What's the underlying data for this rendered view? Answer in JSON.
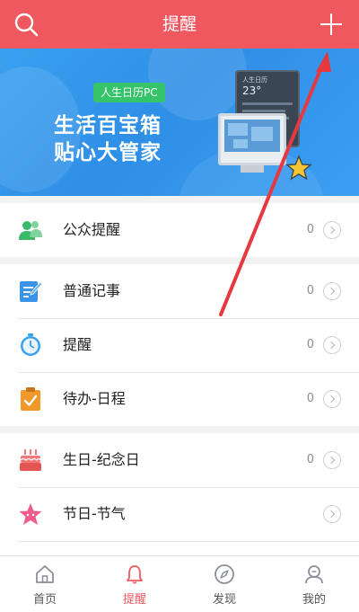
{
  "header": {
    "title": "提醒"
  },
  "banner": {
    "tag": "人生日历PC",
    "line1": "生活百宝箱",
    "line2": "贴心大管家",
    "screen_header": "人生日历",
    "screen_temp": "23°"
  },
  "groups": [
    {
      "items": [
        {
          "label": "公众提醒",
          "count": "0",
          "icon": "people-icon"
        }
      ]
    },
    {
      "items": [
        {
          "label": "普通记事",
          "count": "0",
          "icon": "notepad-icon"
        },
        {
          "label": "提醒",
          "count": "0",
          "icon": "alarm-clock-icon"
        },
        {
          "label": "待办-日程",
          "count": "0",
          "icon": "clipboard-check-icon"
        }
      ]
    },
    {
      "items": [
        {
          "label": "生日-纪念日",
          "count": "0",
          "icon": "cake-icon"
        },
        {
          "label": "节日-节气",
          "count": "",
          "icon": "star-icon"
        }
      ]
    }
  ],
  "tabbar": {
    "tabs": [
      {
        "label": "首页",
        "icon": "home-icon",
        "active": false
      },
      {
        "label": "提醒",
        "icon": "bell-icon",
        "active": true
      },
      {
        "label": "发现",
        "icon": "compass-icon",
        "active": false
      },
      {
        "label": "我的",
        "icon": "user-icon",
        "active": false
      }
    ]
  },
  "colors": {
    "accent": "#f05860",
    "banner_blue": "#2f8fe6",
    "arrow": "#e5383f"
  }
}
